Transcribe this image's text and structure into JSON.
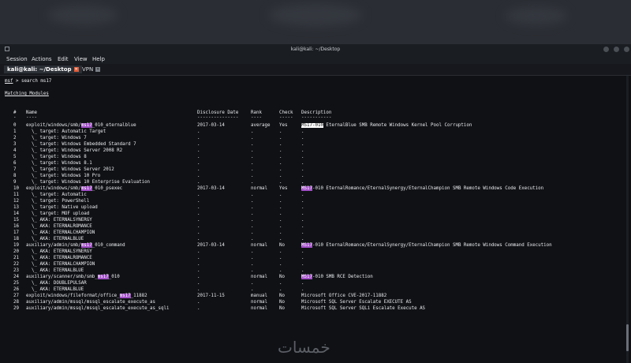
{
  "window": {
    "title": "kali@kali: ~/Desktop"
  },
  "menu": [
    "Session",
    "Actions",
    "Edit",
    "View",
    "Help"
  ],
  "tabs": [
    {
      "label": "kali@kali: ~/Desktop",
      "active": true
    },
    {
      "label": "VPN",
      "active": false
    }
  ],
  "terminal": {
    "prompt": "msf",
    "command": " > search ms17",
    "section": "Matching Modules",
    "headers": {
      "num": "#",
      "name": "Name",
      "date": "Disclosure Date",
      "rank": "Rank",
      "check": "Check",
      "desc": "Description"
    },
    "rows": [
      {
        "n": "0",
        "name": [
          "exploit/windows/smb/",
          "ms17",
          "_010_eternalblue"
        ],
        "date": "2017-03-14",
        "rank": "average",
        "check": "Yes",
        "desc": [
          "",
          "MS17-010",
          " EternalBlue SMB Remote Windows Kernel Pool Corruption"
        ],
        "descStyle": "w"
      },
      {
        "n": "1",
        "name": [
          "  \\_ target: Automatic Target"
        ],
        "date": ".",
        "rank": ".",
        "check": ".",
        "desc": [
          "."
        ]
      },
      {
        "n": "2",
        "name": [
          "  \\_ target: Windows 7"
        ],
        "date": ".",
        "rank": ".",
        "check": ".",
        "desc": [
          "."
        ]
      },
      {
        "n": "3",
        "name": [
          "  \\_ target: Windows Embedded Standard 7"
        ],
        "date": ".",
        "rank": ".",
        "check": ".",
        "desc": [
          "."
        ]
      },
      {
        "n": "4",
        "name": [
          "  \\_ target: Windows Server 2008 R2"
        ],
        "date": ".",
        "rank": ".",
        "check": ".",
        "desc": [
          "."
        ]
      },
      {
        "n": "5",
        "name": [
          "  \\_ target: Windows 8"
        ],
        "date": ".",
        "rank": ".",
        "check": ".",
        "desc": [
          "."
        ]
      },
      {
        "n": "6",
        "name": [
          "  \\_ target: Windows 8.1"
        ],
        "date": ".",
        "rank": ".",
        "check": ".",
        "desc": [
          "."
        ]
      },
      {
        "n": "7",
        "name": [
          "  \\_ target: Windows Server 2012"
        ],
        "date": ".",
        "rank": ".",
        "check": ".",
        "desc": [
          "."
        ]
      },
      {
        "n": "8",
        "name": [
          "  \\_ target: Windows 10 Pro"
        ],
        "date": ".",
        "rank": ".",
        "check": ".",
        "desc": [
          "."
        ]
      },
      {
        "n": "9",
        "name": [
          "  \\_ target: Windows 10 Enterprise Evaluation"
        ],
        "date": ".",
        "rank": ".",
        "check": ".",
        "desc": [
          "."
        ]
      },
      {
        "n": "10",
        "name": [
          "exploit/windows/smb/",
          "ms17",
          "_010_psexec"
        ],
        "date": "2017-03-14",
        "rank": "normal",
        "check": "Yes",
        "desc": [
          "",
          "MS17",
          "-010 EternalRomance/EternalSynergy/EternalChampion SMB Remote Windows Code Execution"
        ]
      },
      {
        "n": "11",
        "name": [
          "  \\_ target: Automatic"
        ],
        "date": ".",
        "rank": ".",
        "check": ".",
        "desc": [
          "."
        ]
      },
      {
        "n": "12",
        "name": [
          "  \\_ target: PowerShell"
        ],
        "date": ".",
        "rank": ".",
        "check": ".",
        "desc": [
          "."
        ]
      },
      {
        "n": "13",
        "name": [
          "  \\_ target: Native upload"
        ],
        "date": ".",
        "rank": ".",
        "check": ".",
        "desc": [
          "."
        ]
      },
      {
        "n": "14",
        "name": [
          "  \\_ target: MOF upload"
        ],
        "date": ".",
        "rank": ".",
        "check": ".",
        "desc": [
          "."
        ]
      },
      {
        "n": "15",
        "name": [
          "  \\_ AKA: ETERNALSYNERGY"
        ],
        "date": ".",
        "rank": ".",
        "check": ".",
        "desc": [
          "."
        ]
      },
      {
        "n": "16",
        "name": [
          "  \\_ AKA: ETERNALROMANCE"
        ],
        "date": ".",
        "rank": ".",
        "check": ".",
        "desc": [
          "."
        ]
      },
      {
        "n": "17",
        "name": [
          "  \\_ AKA: ETERNALCHAMPION"
        ],
        "date": ".",
        "rank": ".",
        "check": ".",
        "desc": [
          "."
        ]
      },
      {
        "n": "18",
        "name": [
          "  \\_ AKA: ETERNALBLUE"
        ],
        "date": ".",
        "rank": ".",
        "check": ".",
        "desc": [
          "."
        ]
      },
      {
        "n": "19",
        "name": [
          "auxiliary/admin/smb/",
          "ms17",
          "_010_command"
        ],
        "date": "2017-03-14",
        "rank": "normal",
        "check": "No",
        "desc": [
          "",
          "MS17",
          "-010 EternalRomance/EternalSynergy/EternalChampion SMB Remote Windows Command Execution"
        ]
      },
      {
        "n": "20",
        "name": [
          "  \\_ AKA: ETERNALSYNERGY"
        ],
        "date": ".",
        "rank": ".",
        "check": ".",
        "desc": [
          "."
        ]
      },
      {
        "n": "21",
        "name": [
          "  \\_ AKA: ETERNALROMANCE"
        ],
        "date": ".",
        "rank": ".",
        "check": ".",
        "desc": [
          "."
        ]
      },
      {
        "n": "22",
        "name": [
          "  \\_ AKA: ETERNALCHAMPION"
        ],
        "date": ".",
        "rank": ".",
        "check": ".",
        "desc": [
          "."
        ]
      },
      {
        "n": "23",
        "name": [
          "  \\_ AKA: ETERNALBLUE"
        ],
        "date": ".",
        "rank": ".",
        "check": ".",
        "desc": [
          "."
        ]
      },
      {
        "n": "24",
        "name": [
          "auxiliary/scanner/smb/smb_",
          "ms17",
          "_010"
        ],
        "date": ".",
        "rank": "normal",
        "check": "No",
        "desc": [
          "",
          "MS17",
          "-010 SMB RCE Detection"
        ]
      },
      {
        "n": "25",
        "name": [
          "  \\_ AKA: DOUBLEPULSAR"
        ],
        "date": ".",
        "rank": ".",
        "check": ".",
        "desc": [
          "."
        ]
      },
      {
        "n": "26",
        "name": [
          "  \\_ AKA: ETERNALBLUE"
        ],
        "date": ".",
        "rank": ".",
        "check": ".",
        "desc": [
          "."
        ]
      },
      {
        "n": "27",
        "name": [
          "exploit/windows/fileformat/office_",
          "ms17",
          "_11882"
        ],
        "date": "2017-11-15",
        "rank": "manual",
        "check": "No",
        "desc": [
          "Microsoft Office CVE-2017-11882"
        ]
      },
      {
        "n": "28",
        "name": [
          "auxiliary/admin/mssql/mssql_escalate_execute_as"
        ],
        "date": ".",
        "rank": "normal",
        "check": "No",
        "desc": [
          "Microsoft SQL Server Escalate EXECUTE AS"
        ]
      },
      {
        "n": "29",
        "name": [
          "auxiliary/admin/mssql/mssql_escalate_execute_as_sqli"
        ],
        "date": ".",
        "rank": "normal",
        "check": "No",
        "desc": [
          "Microsoft SQL Server SQLi Escalate Execute AS"
        ]
      }
    ]
  },
  "watermark": "خمسات"
}
